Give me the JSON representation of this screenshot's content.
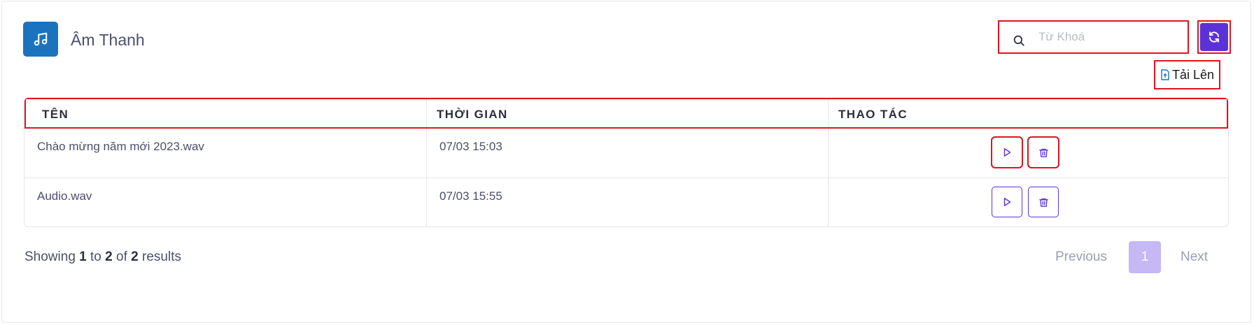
{
  "header": {
    "title": "Âm Thanh",
    "icon": "music-note-icon",
    "brand_color": "#1b73bf"
  },
  "search": {
    "placeholder": "Từ Khoá",
    "value": ""
  },
  "toolbar": {
    "refresh_icon": "refresh-icon",
    "upload_label": "Tải Lên",
    "upload_icon": "file-upload-icon",
    "accent_color": "#5b32d8"
  },
  "table": {
    "columns": [
      "TÊN",
      "THỜI GIAN",
      "THAO TÁC"
    ],
    "rows": [
      {
        "name": "Chào mừng năm mới 2023.wav",
        "time": "07/03 15:03"
      },
      {
        "name": "Audio.wav",
        "time": "07/03 15:55"
      }
    ],
    "row_actions": [
      "play-icon",
      "trash-icon"
    ]
  },
  "footer": {
    "showing_prefix": "Showing",
    "from": "1",
    "to_word": "to",
    "to": "2",
    "of_word": "of",
    "total": "2",
    "results_word": "results"
  },
  "pagination": {
    "previous": "Previous",
    "current": "1",
    "next": "Next"
  }
}
